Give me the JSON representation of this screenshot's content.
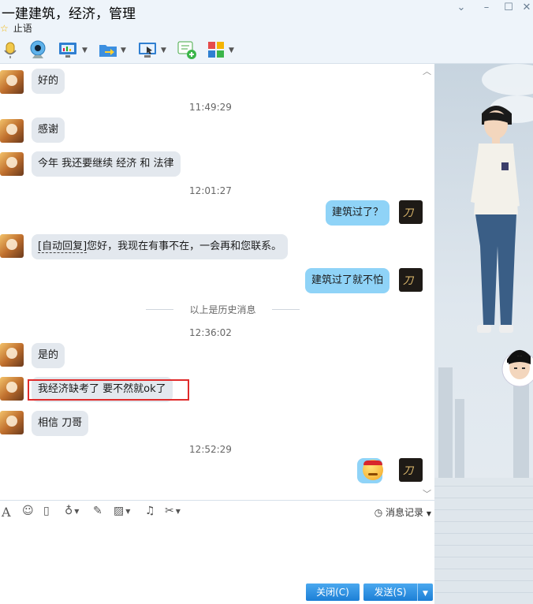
{
  "window": {
    "title": "一建建筑，经济，管理",
    "status_text": "止语",
    "controls": [
      "minimize",
      "maximize",
      "close"
    ]
  },
  "toolbar": {
    "items": [
      {
        "name": "voice-call-icon"
      },
      {
        "name": "video-call-icon"
      },
      {
        "name": "screen-share-icon"
      },
      {
        "name": "send-file-icon"
      },
      {
        "name": "remote-assist-icon"
      },
      {
        "name": "create-group-icon"
      },
      {
        "name": "apps-icon"
      }
    ]
  },
  "messages": [
    {
      "side": "left",
      "text": "好的"
    },
    {
      "time": "11:49:29"
    },
    {
      "side": "left",
      "text": "感谢"
    },
    {
      "side": "left",
      "text": "今年 我还要继续 经济  和  法律"
    },
    {
      "time": "12:01:27"
    },
    {
      "side": "right",
      "text": "建筑过了？"
    },
    {
      "side": "left",
      "text_prefix": "[自动回复]",
      "text": "您好，我现在有事不在，一会再和您联系。"
    },
    {
      "side": "right",
      "text": "建筑过了就不怕"
    },
    {
      "divider": "以上是历史消息"
    },
    {
      "time": "12:36:02"
    },
    {
      "side": "left",
      "text": "是的"
    },
    {
      "side": "left",
      "text": "我经济缺考了  要不然就ok了",
      "highlighted": true
    },
    {
      "side": "left",
      "text": "相信 刀哥"
    },
    {
      "time": "12:52:29"
    },
    {
      "side": "right",
      "emoji": "emoticon-icon"
    }
  ],
  "input_toolbar": {
    "history_label": "消息记录"
  },
  "buttons": {
    "close_label": "关闭(C)",
    "send_label": "发送(S)"
  },
  "colors": {
    "left_bubble": "#e3e8ee",
    "right_bubble": "#8fd3f7",
    "highlight_box": "#e02b2b",
    "button": "#1c7fd6"
  }
}
